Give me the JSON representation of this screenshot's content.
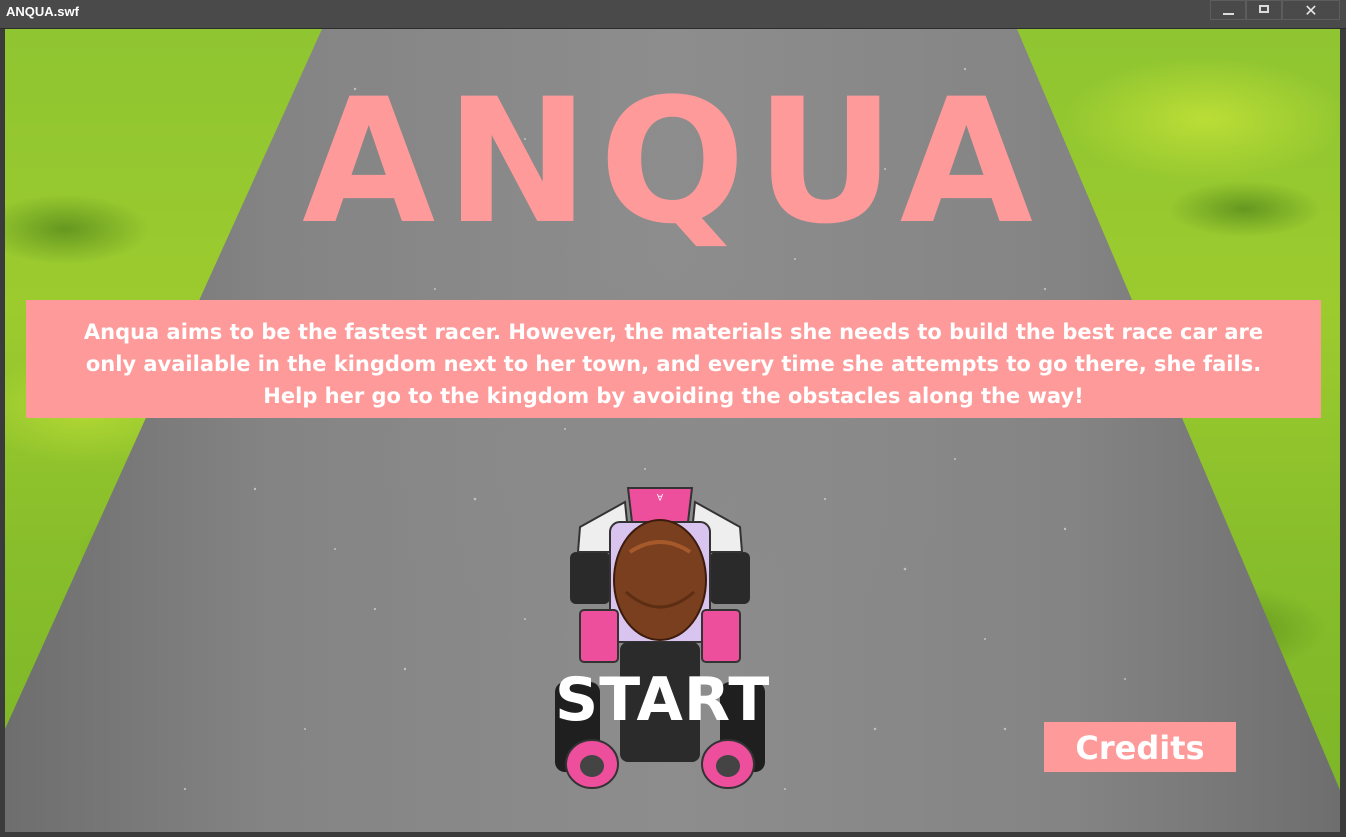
{
  "window": {
    "title": "ANQUA.swf",
    "close_glyph": "✕"
  },
  "game": {
    "title": "ANQUA",
    "description": "Anqua aims to be the fastest racer. However, the materials she needs to build the best race car are only available in the kingdom next to her town, and every time she attempts to go there, she fails. Help her go to the kingdom by avoiding the obstacles along the way!",
    "start_label": "START",
    "credits_label": "Credits",
    "kart_letter": "A"
  },
  "colors": {
    "accent_pink": "#ff9a9a",
    "grass": "#8fc531",
    "road": "#848484",
    "text": "#ffffff"
  }
}
